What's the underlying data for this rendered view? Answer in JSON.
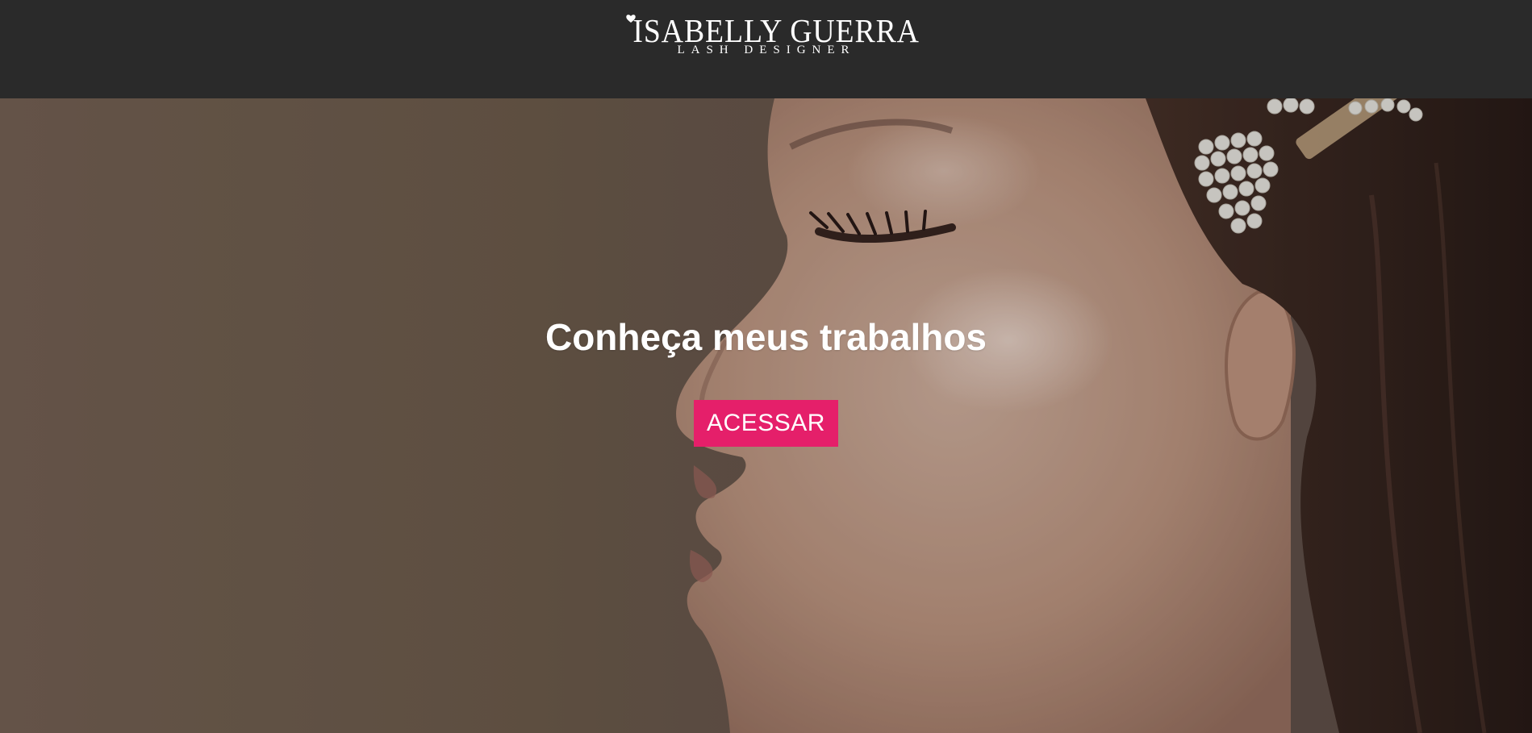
{
  "header": {
    "logo": {
      "name": "ISABELLY GUERRA",
      "tagline": "LASH DESIGNER",
      "icon": "heart-icon"
    }
  },
  "hero": {
    "title": "Conheça meus trabalhos",
    "button_label": "ACESSAR",
    "image": "woman-profile-with-pearl-hair-clip"
  },
  "colors": {
    "header_bg": "#2a2a2a",
    "button_bg": "#e51f6a",
    "text": "#ffffff"
  }
}
